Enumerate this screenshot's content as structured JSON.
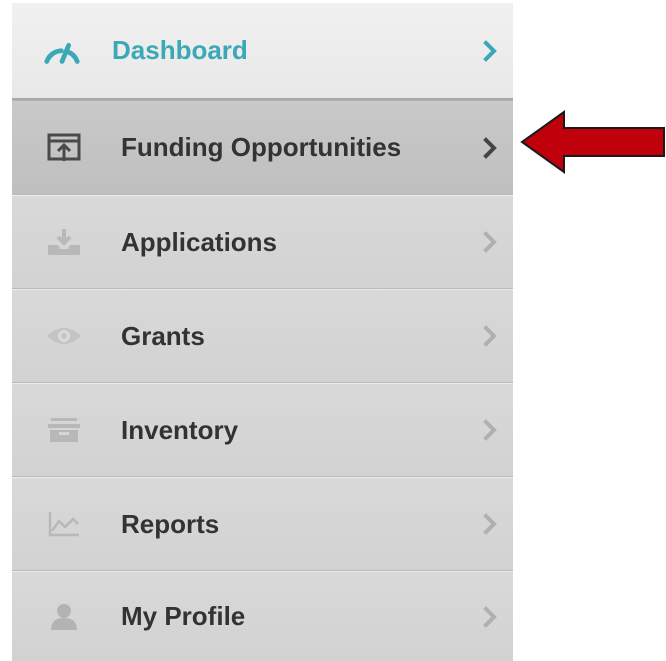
{
  "sidebar": {
    "items": [
      {
        "label": "Dashboard",
        "icon": "speedometer-icon"
      },
      {
        "label": "Funding Opportunities",
        "icon": "upload-box-icon"
      },
      {
        "label": "Applications",
        "icon": "download-tray-icon"
      },
      {
        "label": "Grants",
        "icon": "eye-icon"
      },
      {
        "label": "Inventory",
        "icon": "archive-box-icon"
      },
      {
        "label": "Reports",
        "icon": "line-chart-icon"
      },
      {
        "label": "My Profile",
        "icon": "user-icon"
      }
    ],
    "active_index": 1
  },
  "colors": {
    "accent": "#3aa8b6",
    "arrow": "#c0000b",
    "label": "#333333",
    "icon_muted": "#b3b3b3"
  }
}
